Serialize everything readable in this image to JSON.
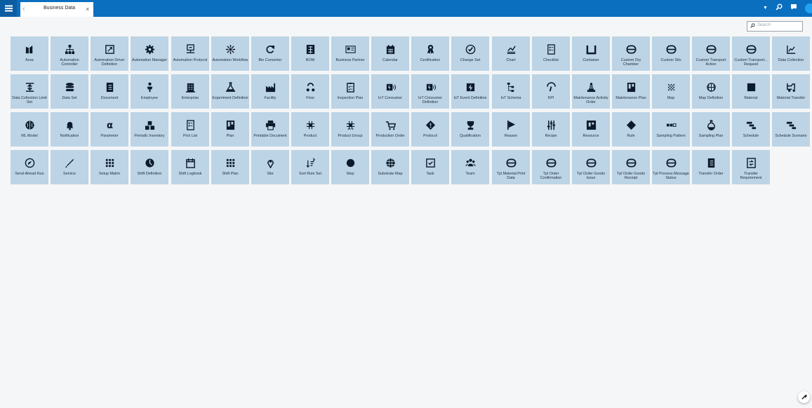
{
  "window": {
    "tab_label": "Business Data",
    "back_glyph": "‹",
    "close_glyph": "×"
  },
  "toolbar": {
    "icons": [
      "menu-icon",
      "caret-down-icon",
      "search-icon",
      "chat-icon",
      "user-avatar"
    ]
  },
  "search": {
    "placeholder": "Search"
  },
  "colors": {
    "header": "#0b6fc0",
    "tile": "#bcd4e5",
    "icon": "#0c1b2b",
    "background": "#f5f6f7"
  },
  "tiles": [
    {
      "label": "Area",
      "icon": "area"
    },
    {
      "label": "Automation Controller",
      "icon": "hierarchy"
    },
    {
      "label": "Automation Driver Definition",
      "icon": "driver"
    },
    {
      "label": "Automation Manager",
      "icon": "gear"
    },
    {
      "label": "Automation Protocol",
      "icon": "monitor"
    },
    {
      "label": "Automation Workflow",
      "icon": "workflow"
    },
    {
      "label": "Bin Converter",
      "icon": "refresh"
    },
    {
      "label": "BOM",
      "icon": "bom"
    },
    {
      "label": "Business Partner",
      "icon": "card"
    },
    {
      "label": "Calendar",
      "icon": "calendar"
    },
    {
      "label": "Certification",
      "icon": "ribbon"
    },
    {
      "label": "Change Set",
      "icon": "check-circle"
    },
    {
      "label": "Chart",
      "icon": "chart"
    },
    {
      "label": "Checklist",
      "icon": "checklist"
    },
    {
      "label": "Container",
      "icon": "container"
    },
    {
      "label": "Custom Dry Chamber",
      "icon": "pill"
    },
    {
      "label": "Custom Silo",
      "icon": "pill"
    },
    {
      "label": "Custom Transport Action",
      "icon": "pill"
    },
    {
      "label": "Custom Transport... Request",
      "icon": "pill"
    },
    {
      "label": "Data Collection",
      "icon": "line-chart"
    },
    {
      "label": "Data Collection Limit Set",
      "icon": "limit"
    },
    {
      "label": "Data Set",
      "icon": "database"
    },
    {
      "label": "Document",
      "icon": "document"
    },
    {
      "label": "Employee",
      "icon": "person"
    },
    {
      "label": "Enterprise",
      "icon": "building"
    },
    {
      "label": "Experiment Definition",
      "icon": "flask"
    },
    {
      "label": "Facility",
      "icon": "factory"
    },
    {
      "label": "Flow",
      "icon": "flow"
    },
    {
      "label": "Inspection Plan",
      "icon": "clipboard"
    },
    {
      "label": "IoT Consumer",
      "icon": "iot"
    },
    {
      "label": "IoT Consumer Definition",
      "icon": "iot"
    },
    {
      "label": "IoT Event Definition",
      "icon": "bolt"
    },
    {
      "label": "IoT Schema",
      "icon": "schema"
    },
    {
      "label": "KPI",
      "icon": "gauge"
    },
    {
      "label": "Maintenance Activity Order",
      "icon": "cone"
    },
    {
      "label": "Maintenance Plan",
      "icon": "board"
    },
    {
      "label": "Map",
      "icon": "dots-grid"
    },
    {
      "label": "Map Definition",
      "icon": "globe"
    },
    {
      "label": "Material",
      "icon": "square"
    },
    {
      "label": "Material Transfer",
      "icon": "transfer"
    },
    {
      "label": "ML Model",
      "icon": "brain"
    },
    {
      "label": "Notification",
      "icon": "bell"
    },
    {
      "label": "Parameter",
      "icon": "alpha"
    },
    {
      "label": "Periodic Inventory",
      "icon": "boxes"
    },
    {
      "label": "Pick List",
      "icon": "checklist"
    },
    {
      "label": "Plan",
      "icon": "board"
    },
    {
      "label": "Printable Document",
      "icon": "printer"
    },
    {
      "label": "Product",
      "icon": "product"
    },
    {
      "label": "Product Group",
      "icon": "product-group"
    },
    {
      "label": "Production Order",
      "icon": "cart"
    },
    {
      "label": "Protocol",
      "icon": "diamond-alert"
    },
    {
      "label": "Qualification",
      "icon": "trophy"
    },
    {
      "label": "Reason",
      "icon": "flag"
    },
    {
      "label": "Recipe",
      "icon": "sliders"
    },
    {
      "label": "Resource",
      "icon": "resource"
    },
    {
      "label": "Rule",
      "icon": "diamond"
    },
    {
      "label": "Sampling Pattern",
      "icon": "sampling"
    },
    {
      "label": "Sampling Plan",
      "icon": "flask-round"
    },
    {
      "label": "Schedule",
      "icon": "gantt"
    },
    {
      "label": "Schedule Scenario",
      "icon": "gantt"
    },
    {
      "label": "Send-Ahead Run",
      "icon": "compass"
    },
    {
      "label": "Service",
      "icon": "pen"
    },
    {
      "label": "Setup Matrix",
      "icon": "matrix"
    },
    {
      "label": "Shift Definition",
      "icon": "clock"
    },
    {
      "label": "Shift Logbook",
      "icon": "calendar-blank"
    },
    {
      "label": "Shift Plan",
      "icon": "matrix"
    },
    {
      "label": "Site",
      "icon": "pin"
    },
    {
      "label": "Sort Rule Set",
      "icon": "sort"
    },
    {
      "label": "Step",
      "icon": "dot"
    },
    {
      "label": "Substrate Map",
      "icon": "wafer"
    },
    {
      "label": "Task",
      "icon": "checkbox"
    },
    {
      "label": "Team",
      "icon": "team"
    },
    {
      "label": "Tpl Material Print Data",
      "icon": "pill"
    },
    {
      "label": "Tpl Order Confirmation",
      "icon": "pill"
    },
    {
      "label": "Tpl Order Goods Issue",
      "icon": "pill"
    },
    {
      "label": "Tpl Order Goods Receipt",
      "icon": "pill"
    },
    {
      "label": "Tpl Process Message Status",
      "icon": "pill"
    },
    {
      "label": "Transfer Order",
      "icon": "document"
    },
    {
      "label": "Transfer Requirement",
      "icon": "transfer-doc"
    }
  ]
}
